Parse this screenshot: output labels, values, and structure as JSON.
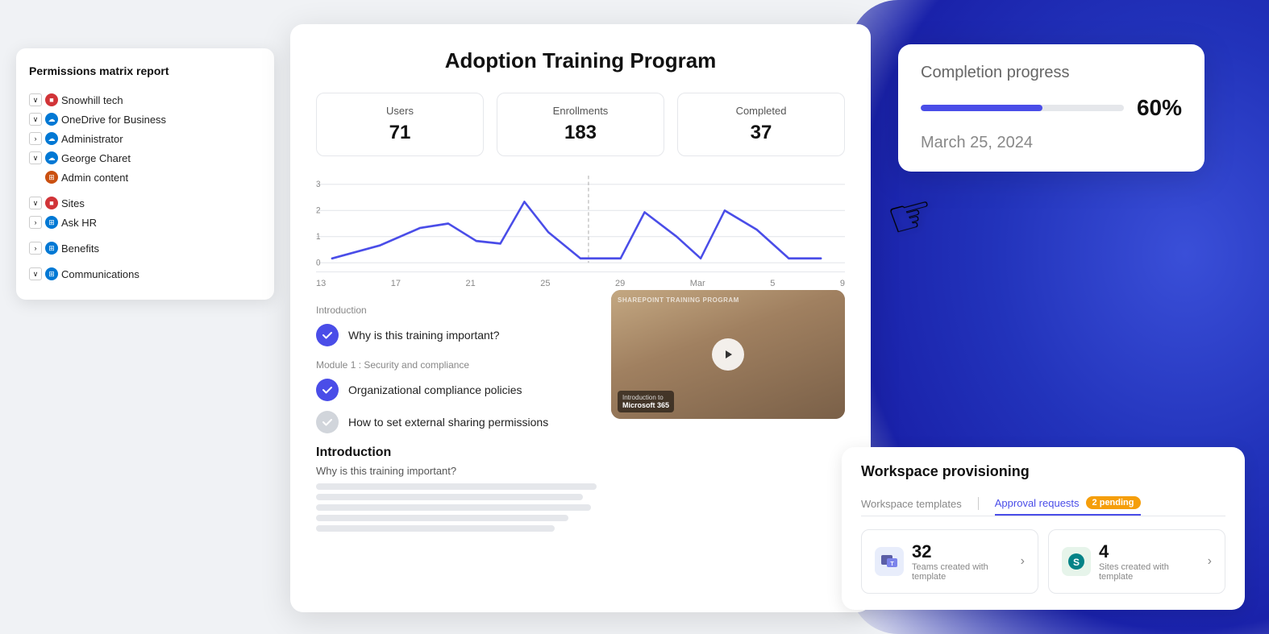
{
  "background": {
    "blob_color": "#2233bb"
  },
  "left_panel": {
    "title": "Permissions matrix report",
    "tree": [
      {
        "id": "snowhill",
        "level": 0,
        "toggle": "v",
        "icon": "ms365",
        "icon_color": "ms-red",
        "label": "Snowhill tech"
      },
      {
        "id": "onedrive",
        "level": 1,
        "toggle": "v",
        "icon": "cloud",
        "icon_color": "ms-blue",
        "label": "OneDrive for Business"
      },
      {
        "id": "admin",
        "level": 2,
        "toggle": ">",
        "icon": "cloud",
        "icon_color": "ms-blue",
        "label": "Administrator"
      },
      {
        "id": "george",
        "level": 2,
        "toggle": "v",
        "icon": "cloud",
        "icon_color": "ms-blue",
        "label": "George Charet"
      },
      {
        "id": "admincontent",
        "level": 3,
        "toggle": null,
        "icon": "grid",
        "icon_color": "ms-orange",
        "label": "Admin content"
      },
      {
        "id": "sites",
        "level": 0,
        "toggle": "v",
        "icon": "ms365",
        "icon_color": "ms-red",
        "label": "Sites"
      },
      {
        "id": "askhr",
        "level": 1,
        "toggle": ">",
        "icon": "network",
        "icon_color": "ms-blue",
        "label": "Ask HR"
      },
      {
        "id": "benefits",
        "level": 0,
        "toggle": ">",
        "icon": "network",
        "icon_color": "ms-blue",
        "label": "Benefits"
      },
      {
        "id": "communications",
        "level": 0,
        "toggle": "v",
        "icon": "network",
        "icon_color": "ms-blue",
        "label": "Communications"
      }
    ]
  },
  "main_card": {
    "title": "Adoption Training Program",
    "stats": [
      {
        "label": "Users",
        "value": "71"
      },
      {
        "label": "Enrollments",
        "value": "183"
      },
      {
        "label": "Completed",
        "value": "37"
      }
    ],
    "chart": {
      "x_labels": [
        "13",
        "17",
        "21",
        "25",
        "29",
        "Mar",
        "5",
        "9"
      ],
      "y_labels": [
        "3",
        "2",
        "1",
        "0"
      ]
    },
    "sections": [
      {
        "label": "Introduction",
        "items": [
          {
            "text": "Why is this training important?",
            "status": "completed"
          }
        ]
      },
      {
        "label": "Module 1 : Security and compliance",
        "items": [
          {
            "text": "Organizational compliance policies",
            "status": "completed"
          },
          {
            "text": "How to set external sharing permissions",
            "status": "pending"
          }
        ]
      }
    ],
    "video": {
      "title_line1": "SHAREPOINT TRAINING PROGRAM",
      "title_line2": "Introduction to",
      "title_line3": "Microsoft 365"
    },
    "intro": {
      "title": "Introduction",
      "subtitle": "Why is this training important?"
    }
  },
  "completion_card": {
    "title": "Completion progress",
    "percent": "60%",
    "percent_value": 60,
    "date": "March 25, 2024"
  },
  "workspace_card": {
    "title": "Workspace provisioning",
    "tabs": [
      {
        "label": "Workspace templates",
        "active": false
      },
      {
        "label": "Approval requests",
        "active": true,
        "badge": "2 pending"
      }
    ],
    "tiles": [
      {
        "id": "teams",
        "number": "32",
        "label": "Teams created with template",
        "icon_color": "teams-icon",
        "icon": "🟦"
      },
      {
        "id": "sharepoint",
        "number": "4",
        "label": "Sites created with template",
        "icon_color": "sharepoint-icon",
        "icon": "🟩"
      }
    ]
  }
}
